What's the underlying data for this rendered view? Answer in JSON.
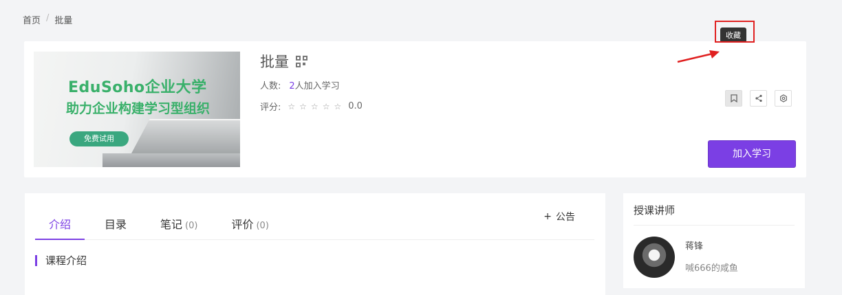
{
  "breadcrumb": {
    "home": "首页",
    "separator": "/",
    "current": "批量"
  },
  "course": {
    "title": "批量",
    "cover": {
      "line1": "EduSoho企业大学",
      "line2": "助力企业构建学习型组织",
      "button": "免费试用"
    },
    "members_label": "人数:",
    "members_count": "2",
    "members_suffix": "人加入学习",
    "rating_label": "评分:",
    "stars": [
      "☆",
      "☆",
      "☆",
      "☆",
      "☆"
    ],
    "rating_value": "0.0"
  },
  "actions": {
    "favorite_tooltip": "收藏",
    "join_label": "加入学习"
  },
  "tabs": [
    {
      "label": "介绍",
      "count": ""
    },
    {
      "label": "目录",
      "count": ""
    },
    {
      "label": "笔记",
      "count": "(0)"
    },
    {
      "label": "评价",
      "count": "(0)"
    }
  ],
  "notice": {
    "plus": "+",
    "label": "公告"
  },
  "intro": {
    "section_title": "课程介绍"
  },
  "teacher": {
    "header": "授课讲师",
    "name": "蒋锋",
    "desc": "喊666的咸鱼"
  },
  "colors": {
    "accent": "#7b3fe4",
    "highlight": "#e02020"
  }
}
